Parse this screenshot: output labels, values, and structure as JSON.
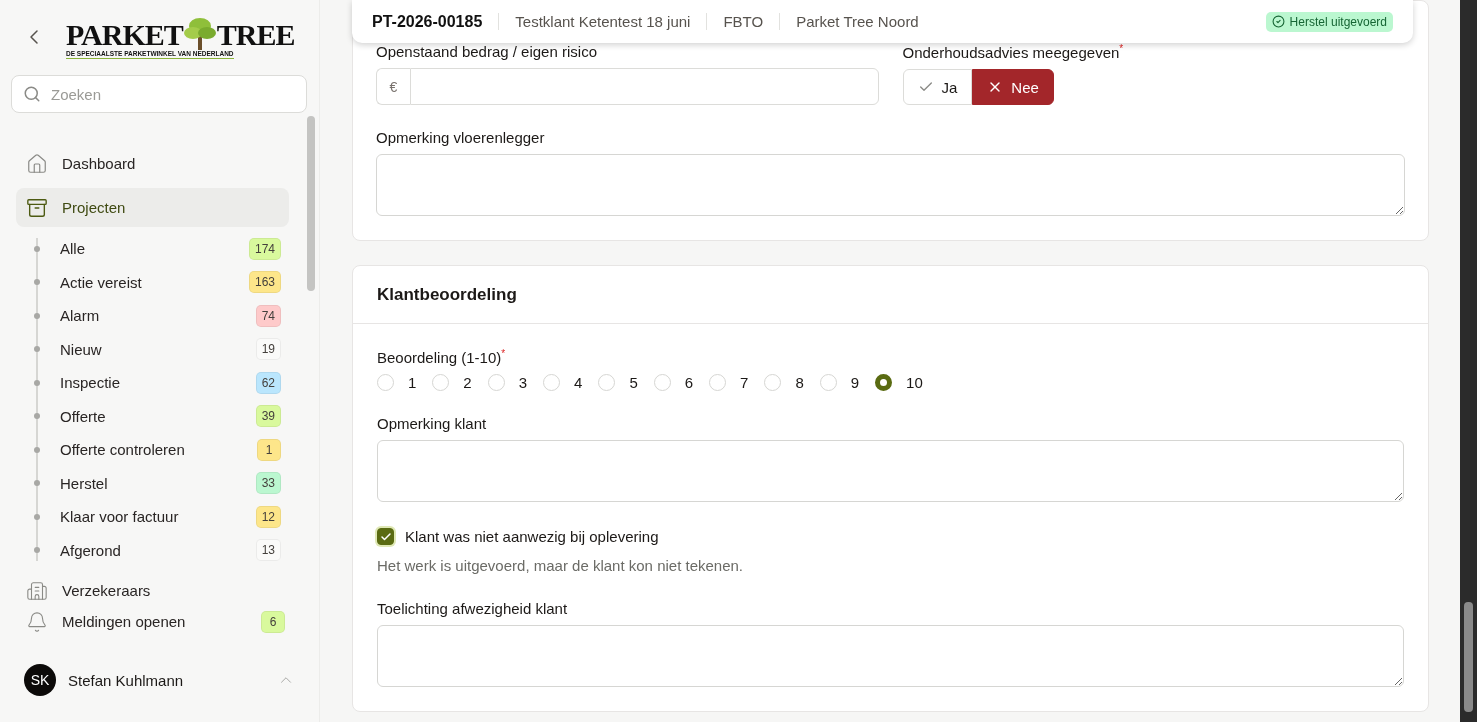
{
  "sidebar": {
    "logo": {
      "left": "PARKET",
      "right": "TREE",
      "tagline": "DE SPECIAALSTE PARKETWINKEL VAN NEDERLAND"
    },
    "search": {
      "placeholder": "Zoeken"
    },
    "nav": [
      {
        "label": "Dashboard",
        "kind": "home",
        "selected": false
      },
      {
        "label": "Projecten",
        "kind": "projects",
        "selected": true,
        "children": [
          {
            "label": "Alle",
            "count": "174",
            "color": "#d9f99d"
          },
          {
            "label": "Actie vereist",
            "count": "163",
            "color": "#fde68a"
          },
          {
            "label": "Alarm",
            "count": "74",
            "color": "#fecaca"
          },
          {
            "label": "Nieuw",
            "count": "19",
            "color": "#fafaf9"
          },
          {
            "label": "Inspectie",
            "count": "62",
            "color": "#bae6fd"
          },
          {
            "label": "Offerte",
            "count": "39",
            "color": "#d9f99d"
          },
          {
            "label": "Offerte controleren",
            "count": "1",
            "color": "#fde68a"
          },
          {
            "label": "Herstel",
            "count": "33",
            "color": "#bbf7d0"
          },
          {
            "label": "Klaar voor factuur",
            "count": "12",
            "color": "#fde68a"
          },
          {
            "label": "Afgerond",
            "count": "13",
            "color": "#fafaf9"
          }
        ]
      },
      {
        "label": "Verzekeraars",
        "kind": "building",
        "selected": false
      }
    ],
    "notifications": {
      "label": "Meldingen openen",
      "count": "6",
      "color": "#d9f99d"
    },
    "user": {
      "initials": "SK",
      "name": "Stefan Kuhlmann"
    }
  },
  "header": {
    "project_id": "PT-2026-00185",
    "fields": [
      "Testklant Ketentest 18 juni",
      "FBTO",
      "Parket Tree Noord"
    ],
    "status": "Herstel uitgevoerd"
  },
  "payment": {
    "label": "Openstaand bedrag / eigen risico",
    "currency": "€"
  },
  "maintenance_advice": {
    "label": "Onderhoudsadvies meegegeven",
    "required_mark": "*",
    "options": [
      {
        "label": "Ja",
        "kind": "yes",
        "selected": false
      },
      {
        "label": "Nee",
        "kind": "no",
        "selected": true
      }
    ]
  },
  "installer_remark": {
    "label": "Opmerking vloerenlegger"
  },
  "rating_section": {
    "title": "Klantbeoordeling",
    "rating": {
      "label": "Beoordeling (1-10)",
      "required_mark": "*",
      "options": [
        {
          "label": "1",
          "selected": false
        },
        {
          "label": "2",
          "selected": false
        },
        {
          "label": "3",
          "selected": false
        },
        {
          "label": "4",
          "selected": false
        },
        {
          "label": "5",
          "selected": false
        },
        {
          "label": "6",
          "selected": false
        },
        {
          "label": "7",
          "selected": false
        },
        {
          "label": "8",
          "selected": false
        },
        {
          "label": "9",
          "selected": false
        },
        {
          "label": "10",
          "selected": true
        }
      ]
    },
    "customer_remark": {
      "label": "Opmerking klant"
    },
    "absent": {
      "label": "Klant was niet aanwezig bij oplevering",
      "checked": true,
      "hint": "Het werk is uitgevoerd, maar de klant kon niet tekenen."
    },
    "absence_note": {
      "label": "Toelichting afwezigheid klant"
    }
  }
}
